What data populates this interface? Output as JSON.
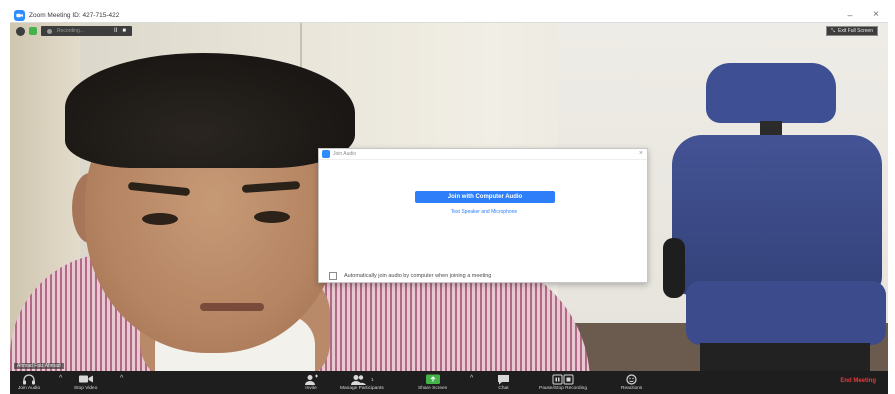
{
  "window": {
    "title": "Zoom Meeting ID: 427-715-422"
  },
  "video": {
    "recording_text": "Recording...",
    "recording_pause": "II",
    "recording_stop": "■",
    "exit_fullscreen_label": "Exit Full Screen",
    "participant_name": "Ahmad Faiz Ahmad"
  },
  "dialog": {
    "title": "Join Audio",
    "close": "×",
    "join_button": "Join with Computer Audio",
    "test_link": "Test Speaker and Microphone",
    "auto_join_label": "Automatically join audio by computer when joining a meeting",
    "auto_join_checked": false
  },
  "toolbar": {
    "join_audio": "Join Audio",
    "stop_video": "Stop Video",
    "invite": "Invite",
    "manage_participants": "Manage Participants",
    "participant_count": "1",
    "share_screen": "Share Screen",
    "chat": "Chat",
    "record": "Pause/Stop Recording",
    "reactions": "Reactions",
    "end_meeting": "End Meeting",
    "caret": "^"
  },
  "colors": {
    "zoom_blue": "#2d8cff",
    "end_red": "#e8393b",
    "share_green": "#45b34a",
    "toolbar_bg": "#1e1e1e"
  }
}
